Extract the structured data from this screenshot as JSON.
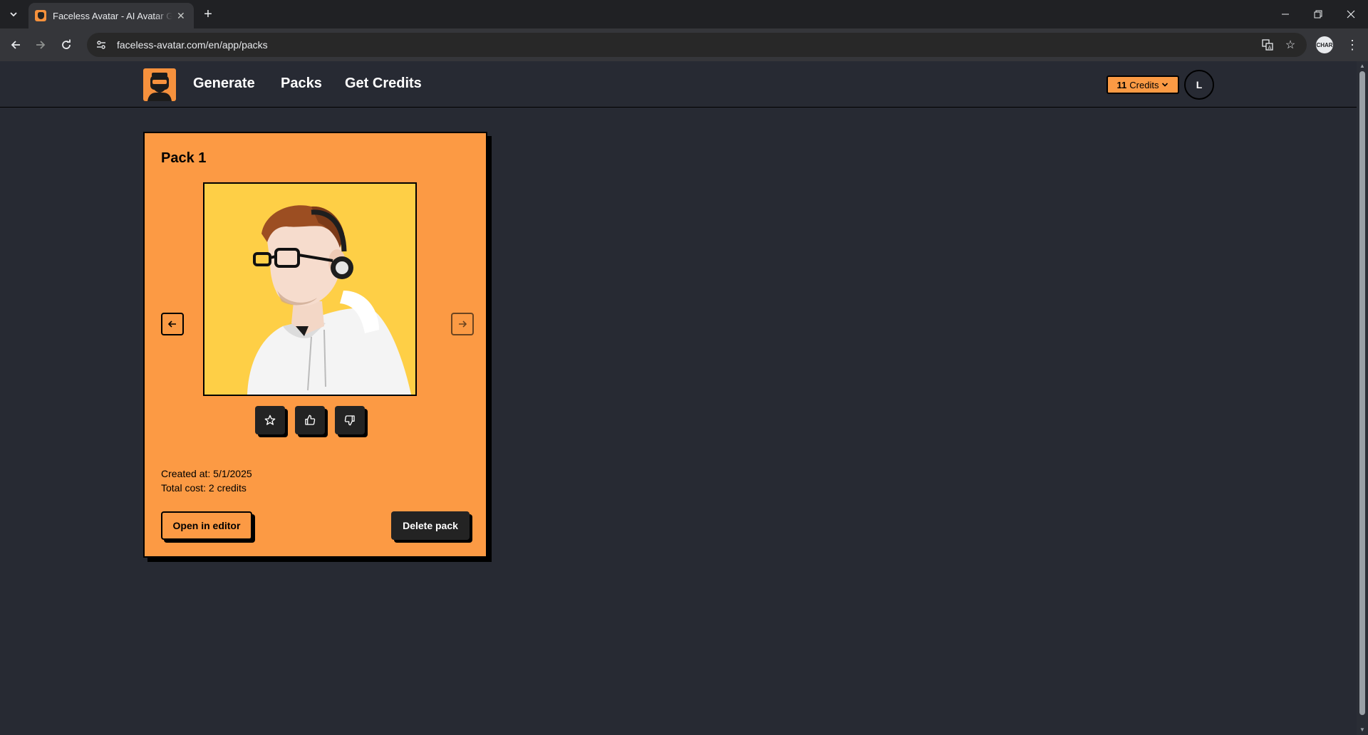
{
  "browser": {
    "tab_title": "Faceless Avatar - AI Avatar Generator",
    "url": "faceless-avatar.com/en/app/packs",
    "extension_label": "CHAR"
  },
  "header": {
    "nav": {
      "generate": "Generate",
      "packs": "Packs",
      "get_credits": "Get Credits"
    },
    "credits": {
      "count": "11",
      "label": "Credits"
    },
    "user_initial": "L"
  },
  "pack": {
    "title": "Pack 1",
    "created_at": "Created at: 5/1/2025",
    "total_cost": "Total cost: 2 credits",
    "open_editor_label": "Open in editor",
    "delete_label": "Delete pack"
  },
  "colors": {
    "page_bg": "#272a33",
    "accent_orange": "#fc9a44",
    "image_bg": "#fecf46",
    "dark_button": "#232323"
  }
}
